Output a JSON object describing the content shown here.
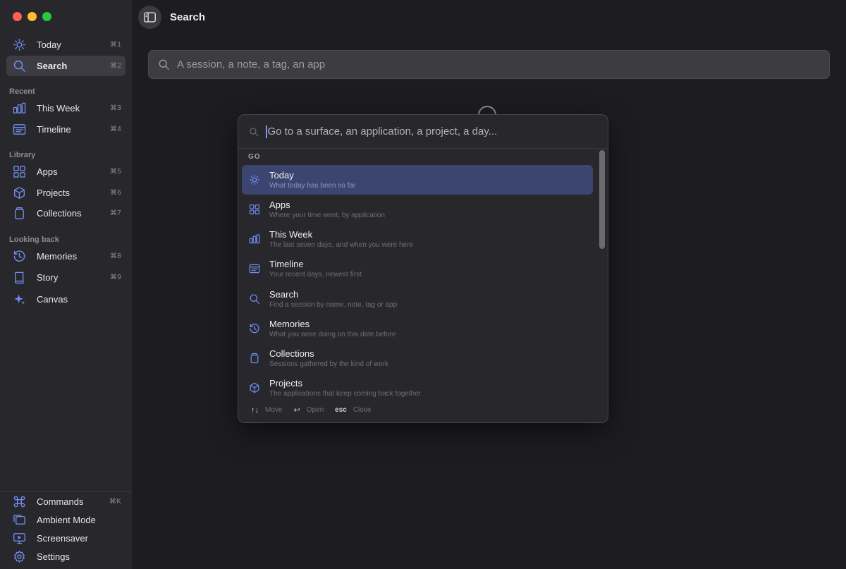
{
  "sidebar": {
    "sections": {
      "recent": "Recent",
      "library": "Library",
      "looking_back": "Looking back"
    },
    "items": [
      {
        "id": "today",
        "label": "Today",
        "shortcut": "⌘1",
        "icon": "sun-icon"
      },
      {
        "id": "search",
        "label": "Search",
        "shortcut": "⌘2",
        "icon": "search-icon",
        "active": true
      },
      {
        "id": "this-week",
        "label": "This Week",
        "shortcut": "⌘3",
        "icon": "bar-chart-icon"
      },
      {
        "id": "timeline",
        "label": "Timeline",
        "shortcut": "⌘4",
        "icon": "timeline-icon"
      },
      {
        "id": "apps",
        "label": "Apps",
        "shortcut": "⌘5",
        "icon": "grid-icon"
      },
      {
        "id": "projects",
        "label": "Projects",
        "shortcut": "⌘6",
        "icon": "cube-icon"
      },
      {
        "id": "collections",
        "label": "Collections",
        "shortcut": "⌘7",
        "icon": "jar-icon"
      },
      {
        "id": "memories",
        "label": "Memories",
        "shortcut": "⌘8",
        "icon": "history-icon"
      },
      {
        "id": "story",
        "label": "Story",
        "shortcut": "⌘9",
        "icon": "book-icon"
      },
      {
        "id": "canvas",
        "label": "Canvas",
        "shortcut": "",
        "icon": "sparkle-icon"
      }
    ],
    "footer": [
      {
        "id": "commands",
        "label": "Commands",
        "shortcut": "⌘K",
        "icon": "command-icon"
      },
      {
        "id": "ambient",
        "label": "Ambient Mode",
        "shortcut": "",
        "icon": "windows-icon"
      },
      {
        "id": "screensaver",
        "label": "Screensaver",
        "shortcut": "",
        "icon": "monitor-icon"
      },
      {
        "id": "settings",
        "label": "Settings",
        "shortcut": "",
        "icon": "gear-icon"
      }
    ]
  },
  "header": {
    "title": "Search"
  },
  "search": {
    "placeholder": "A session, a note, a tag, an app"
  },
  "palette": {
    "placeholder": "Go to a surface, an application, a project, a day...",
    "group_label": "GO",
    "items": [
      {
        "title": "Today",
        "subtitle": "What today has been so far",
        "icon": "sun-icon",
        "selected": true
      },
      {
        "title": "Apps",
        "subtitle": "Where your time went, by application",
        "icon": "grid-icon"
      },
      {
        "title": "This Week",
        "subtitle": "The last seven days, and when you were here",
        "icon": "bar-chart-icon"
      },
      {
        "title": "Timeline",
        "subtitle": "Your recent days, newest first",
        "icon": "timeline-icon"
      },
      {
        "title": "Search",
        "subtitle": "Find a session by name, note, tag or app",
        "icon": "search-icon"
      },
      {
        "title": "Memories",
        "subtitle": "What you were doing on this date before",
        "icon": "history-icon"
      },
      {
        "title": "Collections",
        "subtitle": "Sessions gathered by the kind of work",
        "icon": "jar-icon"
      },
      {
        "title": "Projects",
        "subtitle": "The applications that keep coming back together",
        "icon": "cube-icon"
      }
    ],
    "footer": {
      "move_key": "↑↓",
      "move_label": "Move",
      "open_key": "↩",
      "open_label": "Open",
      "close_key": "esc",
      "close_label": "Close"
    }
  },
  "colors": {
    "accent": "#6f8ff0",
    "selection": "#3b4570",
    "background": "#1d1d20",
    "sidebar": "#28282c"
  }
}
